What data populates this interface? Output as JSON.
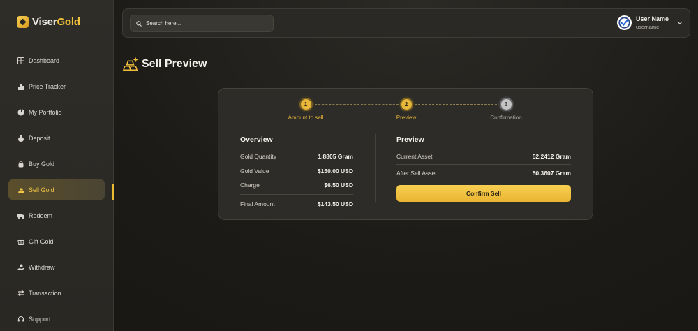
{
  "brand": {
    "name_part1": "Viser",
    "name_part2": "Gold"
  },
  "sidebar": {
    "items": [
      {
        "label": "Dashboard",
        "icon": "grid-icon"
      },
      {
        "label": "Price Tracker",
        "icon": "bar-chart-icon"
      },
      {
        "label": "My Portfolio",
        "icon": "pie-chart-icon"
      },
      {
        "label": "Deposit",
        "icon": "money-bag-icon"
      },
      {
        "label": "Buy Gold",
        "icon": "lock-bag-icon"
      },
      {
        "label": "Sell Gold",
        "icon": "gold-bars-icon",
        "active": true
      },
      {
        "label": "Redeem",
        "icon": "truck-icon"
      },
      {
        "label": "Gift Gold",
        "icon": "gift-icon"
      },
      {
        "label": "Withdraw",
        "icon": "hand-coin-icon"
      },
      {
        "label": "Transaction",
        "icon": "transfer-icon"
      },
      {
        "label": "Support",
        "icon": "headset-icon"
      }
    ]
  },
  "header": {
    "search_placeholder": "Search here...",
    "user": {
      "name": "User Name",
      "username": "username"
    }
  },
  "page": {
    "title": "Sell Preview"
  },
  "steps": [
    {
      "number": "1",
      "label": "Amount to sell",
      "state": "done"
    },
    {
      "number": "2",
      "label": "Preview",
      "state": "active"
    },
    {
      "number": "3",
      "label": "Confirmation",
      "state": "pending"
    }
  ],
  "overview": {
    "title": "Overview",
    "rows": [
      {
        "label": "Gold Quantity",
        "value": "1.8805 Gram"
      },
      {
        "label": "Gold Value",
        "value": "$150.00 USD"
      },
      {
        "label": "Charge",
        "value": "$6.50 USD"
      }
    ],
    "total": {
      "label": "Final Amount",
      "value": "$143.50 USD"
    }
  },
  "preview": {
    "title": "Preview",
    "rows": [
      {
        "label": "Current Asset",
        "value": "52.2412 Gram"
      }
    ],
    "total": {
      "label": "After Sell Asset",
      "value": "50.3607 Gram"
    },
    "confirm_label": "Confirm Sell"
  },
  "colors": {
    "accent": "#e9b532",
    "background": "#1d1b18",
    "sidebar": "#2c2a25"
  }
}
